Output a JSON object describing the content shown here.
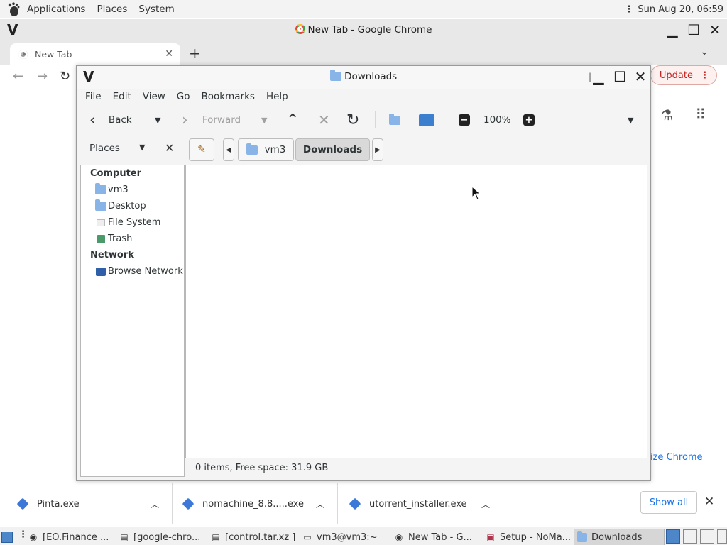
{
  "top_panel": {
    "menus": [
      "Applications",
      "Places",
      "System"
    ],
    "clock": "Sun Aug 20, 06:59"
  },
  "chrome": {
    "window_title": "New Tab - Google Chrome",
    "tab_title": "New Tab",
    "update_label": "Update",
    "customize_label": "ize Chrome"
  },
  "caja": {
    "window_title": "Downloads",
    "menus": [
      "File",
      "Edit",
      "View",
      "Go",
      "Bookmarks",
      "Help"
    ],
    "back_label": "Back",
    "forward_label": "Forward",
    "zoom": "100%",
    "places_label": "Places",
    "breadcrumbs": [
      "vm3",
      "Downloads"
    ],
    "sidebar": {
      "computer_header": "Computer",
      "computer_items": [
        "vm3",
        "Desktop",
        "File System",
        "Trash"
      ],
      "network_header": "Network",
      "network_items": [
        "Browse Network"
      ]
    },
    "status": "0 items, Free space: 31.9 GB"
  },
  "downloads_shelf": {
    "items": [
      "Pinta.exe",
      "nomachine_8.8.....exe",
      "utorrent_installer.exe"
    ],
    "show_all": "Show all"
  },
  "taskbar": {
    "items": [
      "[EO.Finance ...",
      "[google-chro...",
      "[control.tar.xz ]",
      "vm3@vm3:~",
      "New Tab - G...",
      "Setup - NoMa...",
      "Downloads"
    ]
  },
  "colors": {
    "accent": "#1a73e8",
    "update_red": "#c5221f",
    "folder_blue": "#5c8ed1"
  }
}
